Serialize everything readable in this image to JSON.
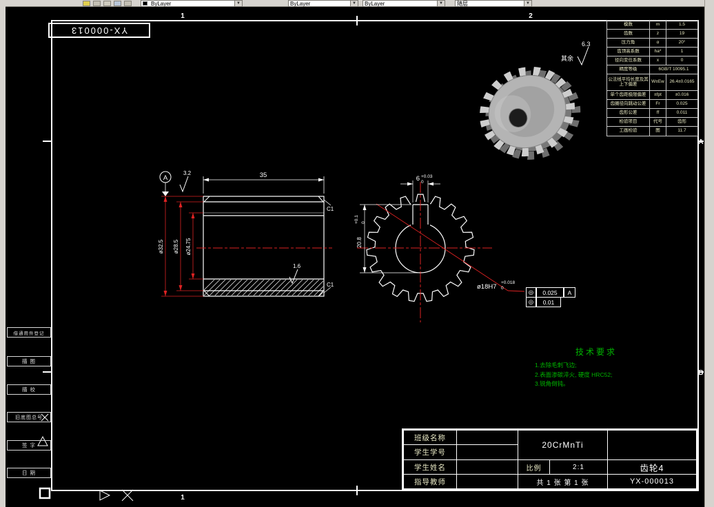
{
  "toolbar": {
    "color_control": "ByLayer",
    "linetype_control": "ByLayer",
    "lineweight_control": "ByLayer",
    "plotstyle_control": "随层"
  },
  "frame": {
    "stamp_number": "YX-000013",
    "zone_top_left": "1",
    "zone_top_right": "2",
    "zone_bottom_left": "1",
    "zone_right_upper": "A",
    "zone_right_lower": "B"
  },
  "roughness_note": {
    "label": "其余",
    "value": "6.3"
  },
  "param_table": {
    "rows": [
      {
        "label": "模数",
        "sym": "m",
        "val": "1.5"
      },
      {
        "label": "齿数",
        "sym": "z",
        "val": "19"
      },
      {
        "label": "压力角",
        "sym": "α",
        "val": "20°"
      },
      {
        "label": "齿顶高系数",
        "sym": "ha*",
        "val": "1"
      },
      {
        "label": "径向变位系数",
        "sym": "x",
        "val": "0"
      },
      {
        "label": "精度等级",
        "sym": "",
        "val": "6GB/T 10095.1"
      },
      {
        "label": "公法线平均长度及其上下偏差",
        "sym": "W±Ew",
        "val": "26.4±0.0165"
      },
      {
        "label": "单个齿距极限偏差",
        "sym": "±fpt",
        "val": "±0.016"
      },
      {
        "label": "齿圈径向跳动公差",
        "sym": "Fr",
        "val": "0.025"
      },
      {
        "label": "齿形公差",
        "sym": "ff",
        "val": "0.011"
      },
      {
        "label": "检验项目",
        "sym": "代号",
        "val": "齿形"
      },
      {
        "label": "工画检验",
        "sym": "图",
        "val": "11.7"
      }
    ]
  },
  "side_view": {
    "dim_width": "35",
    "dim_od": "ø32.5",
    "dim_pd": "ø28.5",
    "dim_rd": "ø24.75",
    "chamfer_top": "C1",
    "chamfer_bottom": "C1",
    "roughness_face": "3.2",
    "roughness_bore": "1.6",
    "datum_label": "A"
  },
  "front_view": {
    "keyway_width": "6",
    "keyway_width_tol_upper": "+0.03",
    "keyway_width_tol_lower": "0",
    "keyway_depth": "20.8",
    "keyway_depth_tol_upper": "+0.1",
    "keyway_depth_tol_lower": "0",
    "bore_dim": "ø18H7",
    "bore_tol_upper": "+0.018",
    "bore_tol_lower": "0",
    "fcf1": {
      "symbol": "◎",
      "tolerance": "0.025",
      "datum": "A"
    },
    "fcf2": {
      "symbol": "◎",
      "tolerance": "0.01"
    }
  },
  "tech_req": {
    "title": "技术要求",
    "lines": [
      "1.去除毛刺飞边;",
      "2.表面渗碳淬火, 硬度 HRC52;",
      "3.锐角倒钝。"
    ]
  },
  "title_block": {
    "row_labels": [
      "班级名称",
      "学生学号",
      "学生姓名",
      "指导教师"
    ],
    "material": "20CrMnTi",
    "scale_label": "比例",
    "scale_value": "2:1",
    "part_name": "齿轮4",
    "sheet_note": "共 1 张 第 1 张",
    "drawing_number": "YX-000013"
  },
  "left_margin": {
    "items": [
      "借通用件登记",
      "描 图",
      "描 校",
      "旧底图总号",
      "签 字",
      "日 期"
    ]
  }
}
